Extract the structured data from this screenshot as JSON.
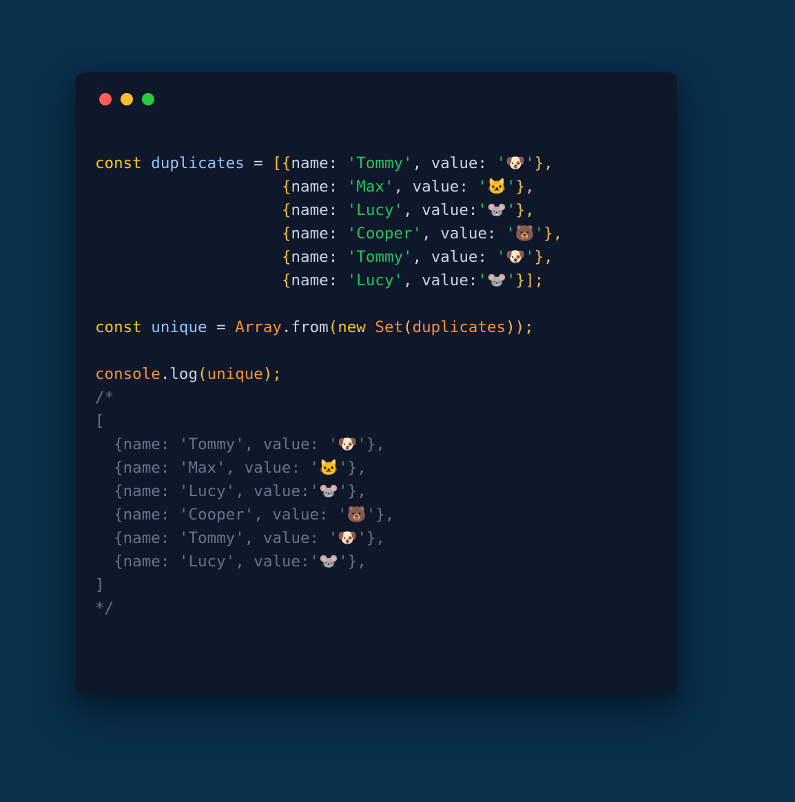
{
  "colors": {
    "page_bg": "#0a2f4a",
    "card_bg": "#0f172a",
    "keyword": "#facc15",
    "variable": "#93c5fd",
    "string": "#22c55e",
    "class": "#fb923c",
    "comment": "#64748b",
    "punct": "#cbd5e1",
    "traffic_red": "#ff5f56",
    "traffic_yellow": "#ffbd2e",
    "traffic_green": "#27c93f"
  },
  "code": {
    "l1": {
      "kw": "const",
      "sp1": " ",
      "var": "duplicates",
      "eq": " = ",
      "open": "[{",
      "k1": "name: ",
      "s1": "'Tommy'",
      "c1": ", ",
      "k2": "value: ",
      "s2": "'🐶'",
      "close": "},"
    },
    "pad": "                    ",
    "l2": {
      "open": "{",
      "k1": "name: ",
      "s1": "'Max'",
      "c1": ", ",
      "k2": "value: ",
      "s2": "'🐱'",
      "close": "},"
    },
    "l3": {
      "open": "{",
      "k1": "name: ",
      "s1": "'Lucy'",
      "c1": ", ",
      "k2": "value:",
      "s2": "'🐭'",
      "close": "},"
    },
    "l4": {
      "open": "{",
      "k1": "name: ",
      "s1": "'Cooper'",
      "c1": ", ",
      "k2": "value: ",
      "s2": "'🐻'",
      "close": "},"
    },
    "l5": {
      "open": "{",
      "k1": "name: ",
      "s1": "'Tommy'",
      "c1": ", ",
      "k2": "value: ",
      "s2": "'🐶'",
      "close": "},"
    },
    "l6": {
      "open": "{",
      "k1": "name: ",
      "s1": "'Lucy'",
      "c1": ", ",
      "k2": "value:",
      "s2": "'🐭'",
      "close": "}];"
    },
    "l8": {
      "kw": "const",
      "sp1": " ",
      "var": "unique",
      "eq": " = ",
      "cls1": "Array",
      "dot": ".",
      "fn": "from",
      "op": "(",
      "new": "new",
      "sp2": " ",
      "cls2": "Set",
      "op2": "(",
      "arg": "duplicates",
      "cp": "));"
    },
    "l10": {
      "obj": "console",
      "dot": ".",
      "fn": "log",
      "op": "(",
      "arg": "unique",
      "cp": ");"
    },
    "comment": {
      "open": "/*",
      "br1": "[",
      "r1": "  {name: 'Tommy', value: '🐶'},",
      "r2": "  {name: 'Max', value: '🐱'},",
      "r3": "  {name: 'Lucy', value:'🐭'},",
      "r4": "  {name: 'Cooper', value: '🐻'},",
      "r5": "  {name: 'Tommy', value: '🐶'},",
      "r6": "  {name: 'Lucy', value:'🐭'},",
      "br2": "]",
      "close": "*/"
    }
  }
}
